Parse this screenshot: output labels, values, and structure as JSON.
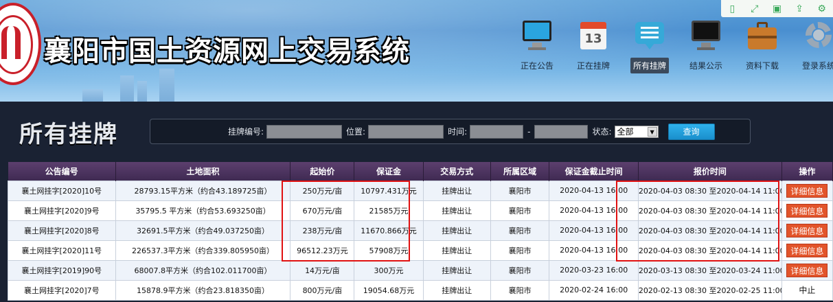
{
  "header": {
    "site_title": "襄阳市国土资源网上交易系统",
    "nav": [
      {
        "label": "正在公告",
        "icon": "monitor-icon",
        "active": false
      },
      {
        "label": "正在挂牌",
        "icon": "calendar-icon",
        "calendar_number": "13",
        "active": false
      },
      {
        "label": "所有挂牌",
        "icon": "message-icon",
        "active": true
      },
      {
        "label": "结果公示",
        "icon": "display-icon",
        "active": false
      },
      {
        "label": "资料下载",
        "icon": "briefcase-icon",
        "active": false
      },
      {
        "label": "登录系统",
        "icon": "gear-icon",
        "active": false
      }
    ],
    "tools": [
      "tablet-icon",
      "fullscreen-icon",
      "save-icon",
      "share-icon",
      "settings-icon"
    ]
  },
  "main": {
    "section_title": "所有挂牌",
    "search": {
      "listing_no_label": "挂牌编号:",
      "location_label": "位置:",
      "time_label": "时间:",
      "time_separator": "-",
      "status_label": "状态:",
      "status_value": "全部",
      "query_label": "查询"
    },
    "table": {
      "headers": [
        "公告编号",
        "土地面积",
        "起始价",
        "保证金",
        "交易方式",
        "所属区域",
        "保证金截止时间",
        "报价时间",
        "操作"
      ],
      "rows": [
        {
          "no": "襄土网挂字[2020]10号",
          "area": "28793.15平方米（约合43.189725亩）",
          "start_price": "250万元/亩",
          "deposit": "10797.431万元",
          "method": "挂牌出让",
          "region": "襄阳市",
          "deadline": "2020-04-13 16:00",
          "quote_time": "2020-04-03 08:30 至2020-04-14 11:00",
          "action": "详细信息"
        },
        {
          "no": "襄土网挂字[2020]9号",
          "area": "35795.5 平方米（约合53.693250亩）",
          "start_price": "670万元/亩",
          "deposit": "21585万元",
          "method": "挂牌出让",
          "region": "襄阳市",
          "deadline": "2020-04-13 16:00",
          "quote_time": "2020-04-03 08:30 至2020-04-14 11:00",
          "action": "详细信息"
        },
        {
          "no": "襄土网挂字[2020]8号",
          "area": "32691.5平方米（约合49.037250亩）",
          "start_price": "238万元/亩",
          "deposit": "11670.866万元",
          "method": "挂牌出让",
          "region": "襄阳市",
          "deadline": "2020-04-13 16:00",
          "quote_time": "2020-04-03 08:30 至2020-04-14 11:00",
          "action": "详细信息"
        },
        {
          "no": "襄土网挂字[2020]11号",
          "area": "226537.3平方米（约合339.805950亩）",
          "start_price": "96512.23万元",
          "deposit": "57908万元",
          "method": "挂牌出让",
          "region": "襄阳市",
          "deadline": "2020-04-13 16:00",
          "quote_time": "2020-04-03 08:30 至2020-04-14 11:00",
          "action": "详细信息"
        },
        {
          "no": "襄土网挂字[2019]90号",
          "area": "68007.8平方米（约合102.011700亩）",
          "start_price": "14万元/亩",
          "deposit": "300万元",
          "method": "挂牌出让",
          "region": "襄阳市",
          "deadline": "2020-03-23 16:00",
          "quote_time": "2020-03-13 08:30 至2020-03-24 11:00",
          "action": "详细信息"
        },
        {
          "no": "襄土网挂字[2020]7号",
          "area": "15878.9平方米（约合23.818350亩）",
          "start_price": "800万元/亩",
          "deposit": "19054.68万元",
          "method": "挂牌出让",
          "region": "襄阳市",
          "deadline": "2020-02-24 16:00",
          "quote_time": "2020-02-13 08:30 至2020-02-25 11:00",
          "action": "中止"
        }
      ]
    }
  }
}
